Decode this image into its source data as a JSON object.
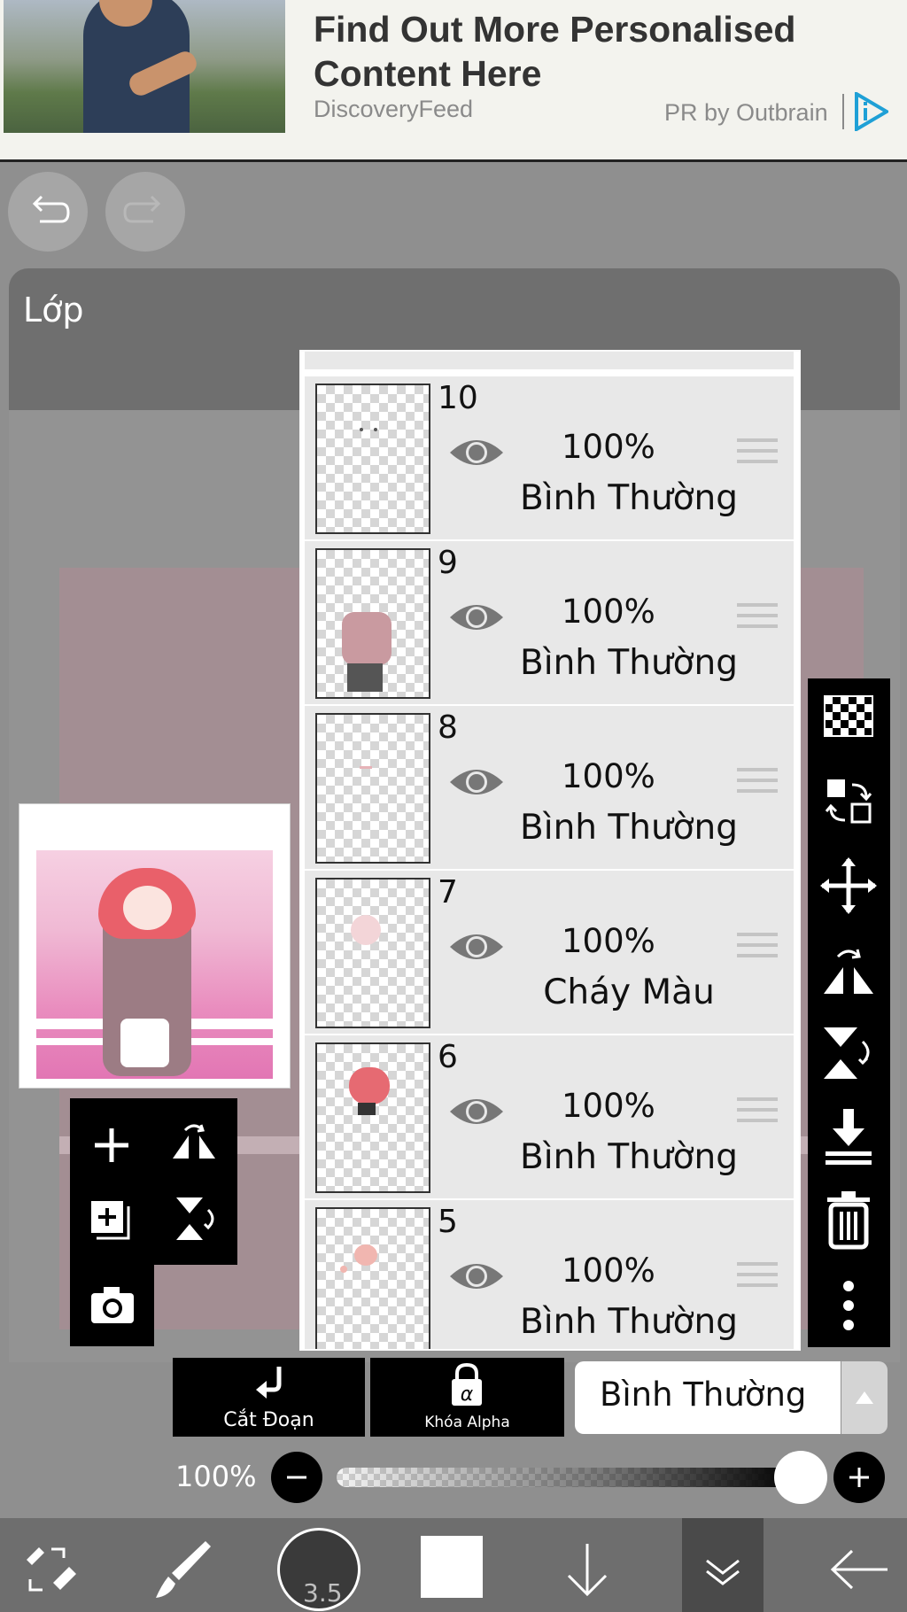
{
  "ad": {
    "title": "Find Out More Personalised Content Here",
    "source": "DiscoveryFeed",
    "sponsor": "PR by Outbrain"
  },
  "panel": {
    "title": "Lớp"
  },
  "layers": [
    {
      "number": "10",
      "opacity": "100%",
      "mode": "Bình Thường"
    },
    {
      "number": "9",
      "opacity": "100%",
      "mode": "Bình Thường"
    },
    {
      "number": "8",
      "opacity": "100%",
      "mode": "Bình Thường"
    },
    {
      "number": "7",
      "opacity": "100%",
      "mode": "Cháy Màu"
    },
    {
      "number": "6",
      "opacity": "100%",
      "mode": "Bình Thường"
    },
    {
      "number": "5",
      "opacity": "100%",
      "mode": "Bình Thường"
    }
  ],
  "options": {
    "clip_label": "Cắt Đoạn",
    "alpha_label": "Khóa Alpha",
    "blend_mode": "Bình Thường"
  },
  "opacity": {
    "label": "100%",
    "value": 1.0
  },
  "brush": {
    "size": "3.5"
  },
  "colors": {
    "accent": "#1fa0d6",
    "panel": "#6f6f6f",
    "background": "#8f8f8f",
    "current_color": "#ffffff"
  }
}
